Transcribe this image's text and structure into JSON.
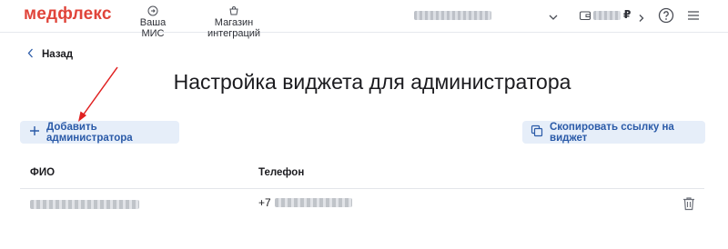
{
  "header": {
    "logo": "медфлекс",
    "nav": [
      {
        "label": "Ваша МИС",
        "icon": "exit-icon"
      },
      {
        "label": "Магазин интеграций",
        "icon": "shop-icon"
      }
    ],
    "balance_currency": "₽"
  },
  "page": {
    "back_label": "Назад",
    "title": "Настройка виджета для администратора",
    "add_button": "Добавить администратора",
    "copy_button": "Скопировать ссылку на виджет"
  },
  "table": {
    "headers": [
      "ФИО",
      "Телефон"
    ],
    "rows": [
      {
        "phone_prefix": "+7"
      }
    ]
  },
  "colors": {
    "brand": "#e0443a",
    "accent": "#2a5aa8",
    "button_bg": "#e6eef9",
    "annotation_arrow": "#e02020"
  }
}
